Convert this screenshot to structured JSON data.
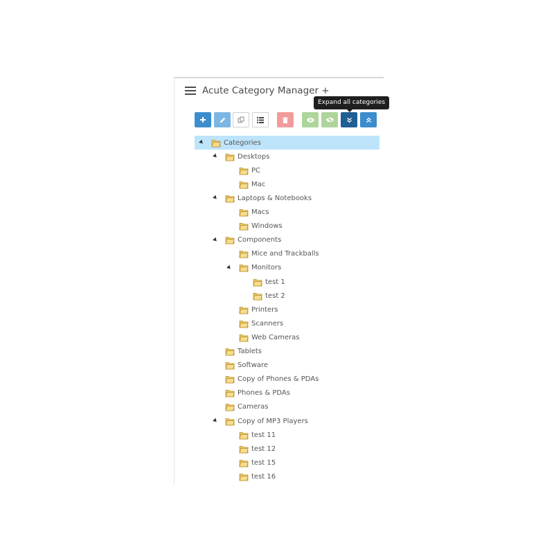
{
  "header": {
    "title": "Acute Category Manager +",
    "icon": "list-icon"
  },
  "toolbar": {
    "buttons": [
      {
        "name": "add-button",
        "icon": "plus-icon",
        "color": "#3c8dcd"
      },
      {
        "name": "edit-button",
        "icon": "pencil-icon",
        "color": "#7cb7e3"
      },
      {
        "name": "copy-button",
        "icon": "copy-icon",
        "color": "#ffffff"
      },
      {
        "name": "list-button",
        "icon": "list-icon",
        "color": "#ffffff"
      },
      {
        "name": "delete-button",
        "icon": "trash-icon",
        "color": "#f19c9c"
      },
      {
        "name": "show-button",
        "icon": "eye-icon",
        "color": "#aed59b"
      },
      {
        "name": "hide-button",
        "icon": "eye-slash-icon",
        "color": "#aed59b"
      },
      {
        "name": "expand-all-button",
        "icon": "chevron-double-down-icon",
        "color": "#1f5f93"
      },
      {
        "name": "collapse-all-button",
        "icon": "chevron-double-up-icon",
        "color": "#3c8dcd"
      }
    ],
    "tooltip": "Expand all categories"
  },
  "tree": {
    "nodes": [
      {
        "label": "Categories",
        "depth": 0,
        "expanded": true,
        "selected": true
      },
      {
        "label": "Desktops",
        "depth": 1,
        "expanded": true
      },
      {
        "label": "PC",
        "depth": 2
      },
      {
        "label": "Mac",
        "depth": 2
      },
      {
        "label": "Laptops & Notebooks",
        "depth": 1,
        "expanded": true
      },
      {
        "label": "Macs",
        "depth": 2
      },
      {
        "label": "Windows",
        "depth": 2
      },
      {
        "label": "Components",
        "depth": 1,
        "expanded": true
      },
      {
        "label": "Mice and Trackballs",
        "depth": 2
      },
      {
        "label": "Monitors",
        "depth": 2,
        "expanded": true
      },
      {
        "label": "test 1",
        "depth": 3
      },
      {
        "label": "test 2",
        "depth": 3
      },
      {
        "label": "Printers",
        "depth": 2
      },
      {
        "label": "Scanners",
        "depth": 2
      },
      {
        "label": "Web Cameras",
        "depth": 2
      },
      {
        "label": "Tablets",
        "depth": 1
      },
      {
        "label": "Software",
        "depth": 1
      },
      {
        "label": "Copy of Phones & PDAs",
        "depth": 1
      },
      {
        "label": "Phones & PDAs",
        "depth": 1
      },
      {
        "label": "Cameras",
        "depth": 1
      },
      {
        "label": "Copy of MP3 Players",
        "depth": 1,
        "expanded": true
      },
      {
        "label": "test 11",
        "depth": 2
      },
      {
        "label": "test 12",
        "depth": 2
      },
      {
        "label": "test 15",
        "depth": 2
      },
      {
        "label": "test 16",
        "depth": 2
      }
    ]
  }
}
